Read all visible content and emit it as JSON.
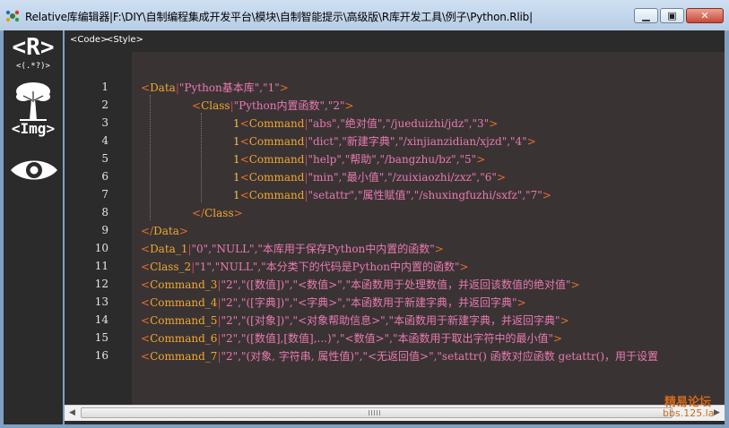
{
  "window": {
    "title": "Relative库编辑器|F:\\DIY\\自制编程集成开发平台\\模块\\自制智能提示\\高级版\\R库开发工具\\例子\\Python.Rlib|",
    "min_label": "▁",
    "max_label": "▣",
    "close_label": "✕"
  },
  "sidebar": {
    "regex_label": "<R>",
    "regex_sub": "<(.*?)>",
    "img_label": "<Img>"
  },
  "tabs": [
    {
      "label": "<Code>"
    },
    {
      "label": "<Style>"
    }
  ],
  "colors": {
    "bracket": "#e8702a",
    "keyword": "#f0a830",
    "pipe": "#c04a6a",
    "string": "#e87ab0",
    "level": "#f0c040"
  },
  "lines": [
    {
      "n": "1",
      "indent": 0,
      "level": "",
      "segments": [
        {
          "t": "<",
          "c": "bracket"
        },
        {
          "t": "Data",
          "c": "keyword"
        },
        {
          "t": "|",
          "c": "pipe"
        },
        {
          "t": "\"Python基本库\",\"1\"",
          "c": "string"
        },
        {
          "t": ">",
          "c": "bracket"
        }
      ]
    },
    {
      "n": "2",
      "indent": 1,
      "level": "",
      "segments": [
        {
          "t": "<",
          "c": "bracket"
        },
        {
          "t": "Class",
          "c": "keyword"
        },
        {
          "t": "|",
          "c": "pipe"
        },
        {
          "t": "\"Python内置函数\",\"2\"",
          "c": "string"
        },
        {
          "t": ">",
          "c": "bracket"
        }
      ]
    },
    {
      "n": "3",
      "indent": 2,
      "level": "1",
      "segments": [
        {
          "t": "<",
          "c": "bracket"
        },
        {
          "t": "Command",
          "c": "keyword"
        },
        {
          "t": "|",
          "c": "pipe"
        },
        {
          "t": "\"abs\",\"绝对值\",\"/jueduizhi/jdz\",\"3\"",
          "c": "string"
        },
        {
          "t": ">",
          "c": "bracket"
        }
      ]
    },
    {
      "n": "4",
      "indent": 2,
      "level": "1",
      "segments": [
        {
          "t": "<",
          "c": "bracket"
        },
        {
          "t": "Command",
          "c": "keyword"
        },
        {
          "t": "|",
          "c": "pipe"
        },
        {
          "t": "\"dict\",\"新建字典\",\"/xinjianzidian/xjzd\",\"4\"",
          "c": "string"
        },
        {
          "t": ">",
          "c": "bracket"
        }
      ]
    },
    {
      "n": "5",
      "indent": 2,
      "level": "1",
      "segments": [
        {
          "t": "<",
          "c": "bracket"
        },
        {
          "t": "Command",
          "c": "keyword"
        },
        {
          "t": "|",
          "c": "pipe"
        },
        {
          "t": "\"help\",\"帮助\",\"/bangzhu/bz\",\"5\"",
          "c": "string"
        },
        {
          "t": ">",
          "c": "bracket"
        }
      ]
    },
    {
      "n": "6",
      "indent": 2,
      "level": "1",
      "segments": [
        {
          "t": "<",
          "c": "bracket"
        },
        {
          "t": "Command",
          "c": "keyword"
        },
        {
          "t": "|",
          "c": "pipe"
        },
        {
          "t": "\"min\",\"最小值\",\"/zuixiaozhi/zxz\",\"6\"",
          "c": "string"
        },
        {
          "t": ">",
          "c": "bracket"
        }
      ]
    },
    {
      "n": "7",
      "indent": 2,
      "level": "1",
      "segments": [
        {
          "t": "<",
          "c": "bracket"
        },
        {
          "t": "Command",
          "c": "keyword"
        },
        {
          "t": "|",
          "c": "pipe"
        },
        {
          "t": "\"setattr\",\"属性赋值\",\"/shuxingfuzhi/sxfz\",\"7\"",
          "c": "string"
        },
        {
          "t": ">",
          "c": "bracket"
        }
      ]
    },
    {
      "n": "8",
      "indent": 1,
      "level": "",
      "segments": [
        {
          "t": "</",
          "c": "bracket"
        },
        {
          "t": "Class",
          "c": "keyword"
        },
        {
          "t": ">",
          "c": "bracket"
        }
      ]
    },
    {
      "n": "9",
      "indent": 0,
      "level": "",
      "segments": [
        {
          "t": "</",
          "c": "bracket"
        },
        {
          "t": "Data",
          "c": "keyword"
        },
        {
          "t": ">",
          "c": "bracket"
        }
      ]
    },
    {
      "n": "10",
      "indent": 0,
      "level": "",
      "segments": [
        {
          "t": "<",
          "c": "bracket"
        },
        {
          "t": "Data_1",
          "c": "keyword"
        },
        {
          "t": "|",
          "c": "pipe"
        },
        {
          "t": "\"0\",\"NULL\",\"本库用于保存Python中内置的函数\"",
          "c": "string"
        },
        {
          "t": ">",
          "c": "bracket"
        }
      ]
    },
    {
      "n": "11",
      "indent": 0,
      "level": "",
      "segments": [
        {
          "t": "<",
          "c": "bracket"
        },
        {
          "t": "Class_2",
          "c": "keyword"
        },
        {
          "t": "|",
          "c": "pipe"
        },
        {
          "t": "\"1\",\"NULL\",\"本分类下的代码是Python中内置的函数\"",
          "c": "string"
        },
        {
          "t": ">",
          "c": "bracket"
        }
      ]
    },
    {
      "n": "12",
      "indent": 0,
      "level": "",
      "segments": [
        {
          "t": "<",
          "c": "bracket"
        },
        {
          "t": "Command_3",
          "c": "keyword"
        },
        {
          "t": "|",
          "c": "pipe"
        },
        {
          "t": "\"2\",\"([数值])\",\"<数值>\",\"本函数用于处理数值，并返回该数值的绝对值\"",
          "c": "string"
        },
        {
          "t": ">",
          "c": "bracket"
        }
      ]
    },
    {
      "n": "13",
      "indent": 0,
      "level": "",
      "segments": [
        {
          "t": "<",
          "c": "bracket"
        },
        {
          "t": "Command_4",
          "c": "keyword"
        },
        {
          "t": "|",
          "c": "pipe"
        },
        {
          "t": "\"2\",\"([字典])\",\"<字典>\",\"本函数用于新建字典，并返回字典\"",
          "c": "string"
        },
        {
          "t": ">",
          "c": "bracket"
        }
      ]
    },
    {
      "n": "14",
      "indent": 0,
      "level": "",
      "segments": [
        {
          "t": "<",
          "c": "bracket"
        },
        {
          "t": "Command_5",
          "c": "keyword"
        },
        {
          "t": "|",
          "c": "pipe"
        },
        {
          "t": "\"2\",\"([对象])\",\"<对象帮助信息>\",\"本函数用于新建字典，并返回字典\"",
          "c": "string"
        },
        {
          "t": ">",
          "c": "bracket"
        }
      ]
    },
    {
      "n": "15",
      "indent": 0,
      "level": "",
      "segments": [
        {
          "t": "<",
          "c": "bracket"
        },
        {
          "t": "Command_6",
          "c": "keyword"
        },
        {
          "t": "|",
          "c": "pipe"
        },
        {
          "t": "\"2\",\"([数值],[数值],...)\",\"<数值>\",\"本函数用于取出字符中的最小值\"",
          "c": "string"
        },
        {
          "t": ">",
          "c": "bracket"
        }
      ]
    },
    {
      "n": "16",
      "indent": 0,
      "level": "",
      "segments": [
        {
          "t": "<",
          "c": "bracket"
        },
        {
          "t": "Command_7",
          "c": "keyword"
        },
        {
          "t": "|",
          "c": "pipe"
        },
        {
          "t": "\"2\",\"(对象, 字符串, 属性值)\",\"<无返回值>\",\"setattr() 函数对应函数 getattr()，用于设置",
          "c": "string"
        }
      ]
    }
  ],
  "watermark": {
    "line1": "精易论坛",
    "line2": "bbs.125.la"
  }
}
